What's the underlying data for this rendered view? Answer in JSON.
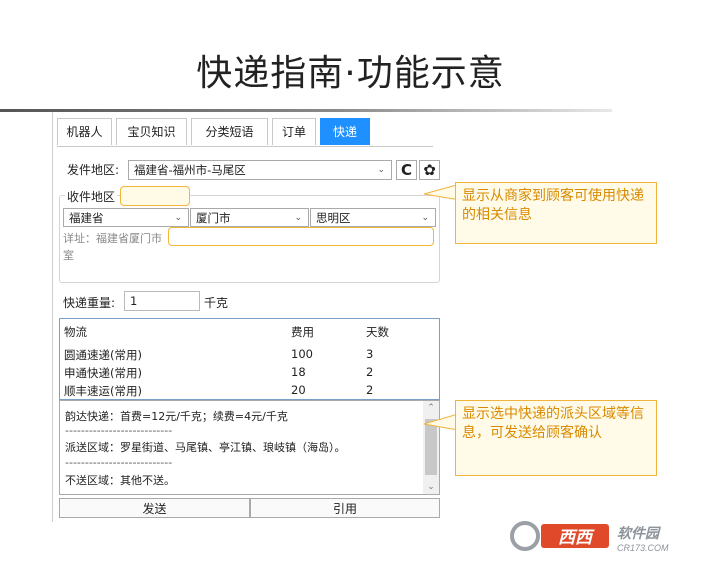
{
  "slide": {
    "title": "快递指南·功能示意"
  },
  "tabs": [
    {
      "label": "机器人"
    },
    {
      "label": "宝贝知识"
    },
    {
      "label": "分类短语"
    },
    {
      "label": "订单"
    },
    {
      "label": "快递",
      "active": true
    }
  ],
  "sender": {
    "label": "发件地区:",
    "value": "福建省-福州市-马尾区",
    "refresh_icon": "refresh-icon",
    "settings_icon": "gear-icon"
  },
  "receiver": {
    "group_label": "收件地区",
    "province": "福建省",
    "city": "厦门市",
    "district": "思明区",
    "address_text_line1": "详址：福建省厦门市",
    "address_text_line2": "室"
  },
  "weight": {
    "label": "快递重量:",
    "value": "1",
    "unit": "千克"
  },
  "table": {
    "headers": [
      "物流",
      "费用",
      "天数"
    ],
    "rows": [
      [
        "圆通速递(常用)",
        "100",
        "3"
      ],
      [
        "申通快递(常用)",
        "18",
        "2"
      ],
      [
        "顺丰速运(常用)",
        "20",
        "2"
      ]
    ]
  },
  "detail": {
    "lines": [
      "韵达快递：首费=12元/千克；续费=4元/千克",
      "---------------------------",
      "派送区域：罗星街道、马尾镇、亭江镇、琅岐镇（海岛）。",
      "---------------------------",
      "不送区域：其他不送。"
    ]
  },
  "buttons": {
    "send": "发送",
    "quote": "引用"
  },
  "callouts": {
    "top": "显示从商家到顾客可使用快递的相关信息",
    "bottom": "显示选中快递的派头区域等信息，可发送给顾客确认"
  },
  "colors": {
    "accent": "#1e90ff",
    "callout_text": "#d98a00",
    "callout_border": "#f0b33c"
  },
  "logo": {
    "text": "西西软件园",
    "sub": "CR173.COM"
  }
}
